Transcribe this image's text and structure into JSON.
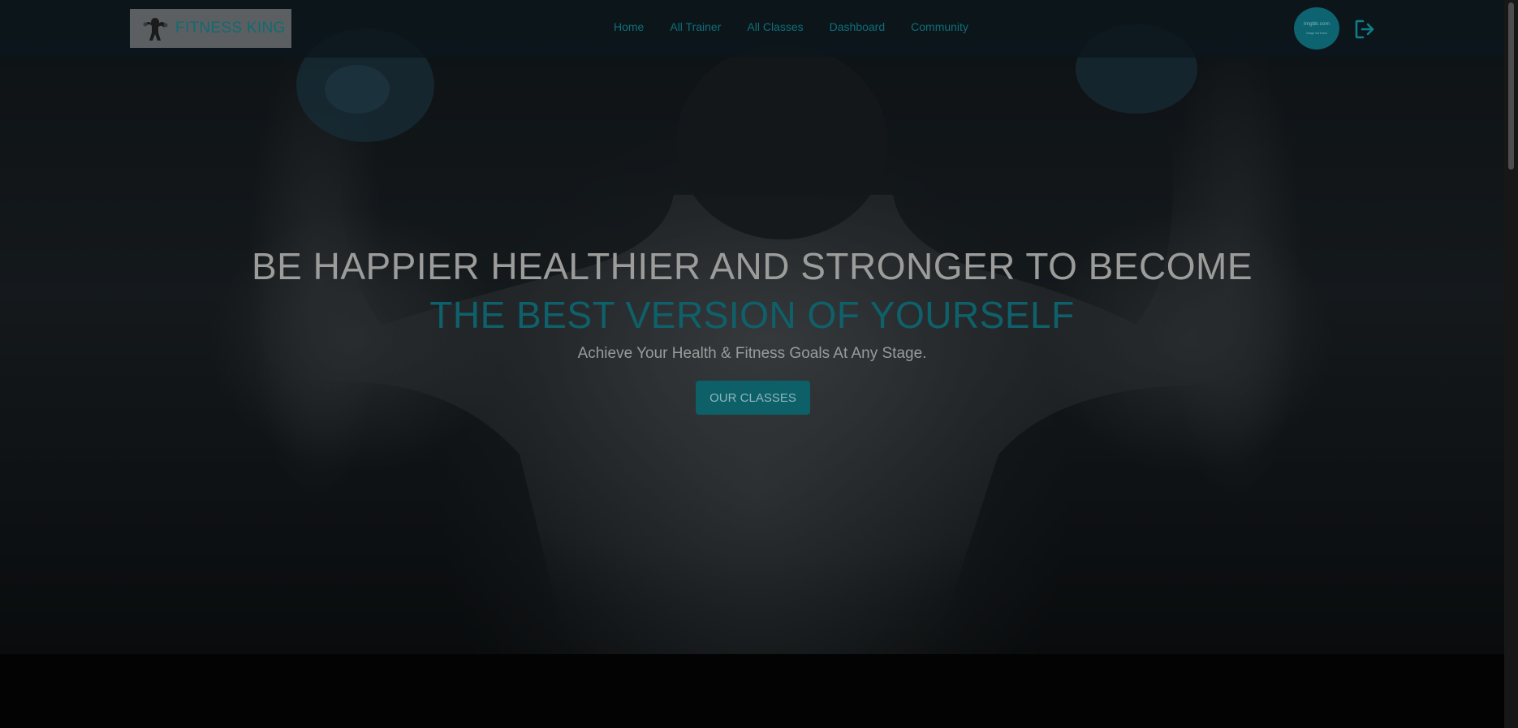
{
  "brand": {
    "name": "FITNESS KING",
    "logo_icon": "flexing-man-logo"
  },
  "nav": {
    "links": [
      {
        "label": "Home"
      },
      {
        "label": "All Trainer"
      },
      {
        "label": "All Classes"
      },
      {
        "label": "Dashboard"
      },
      {
        "label": "Community"
      }
    ]
  },
  "user": {
    "avatar_line1": "imgbb.com",
    "avatar_line2": "image not found",
    "logout_icon": "logout-icon"
  },
  "hero": {
    "headline_line1": "BE HAPPIER HEALTHIER AND STRONGER TO BECOME",
    "headline_line2": "THE BEST VERSION OF YOURSELF",
    "subheadline": "Achieve Your Health & Fitness Goals At Any Stage.",
    "cta_label": "OUR CLASSES"
  },
  "colors": {
    "accent": "#0e6f78",
    "headline": "#9c9c9b",
    "background": "#040506"
  }
}
